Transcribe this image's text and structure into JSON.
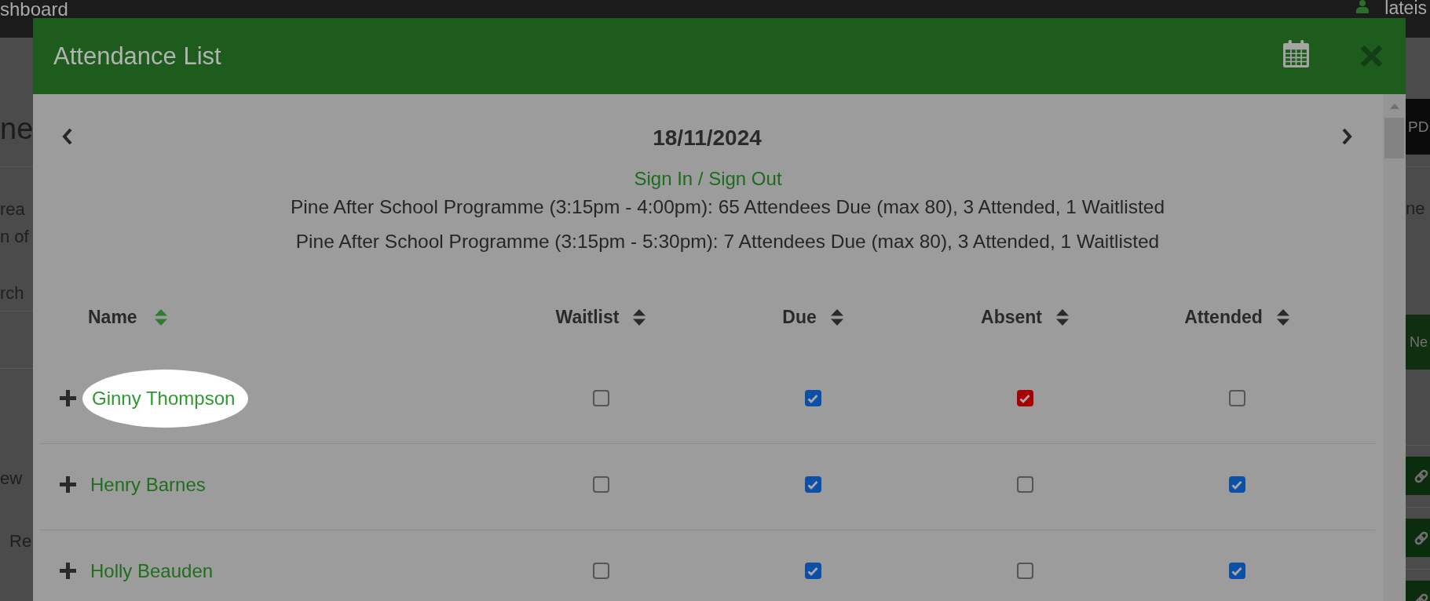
{
  "top_bar": {
    "title": "shboard",
    "user_name": "lateis"
  },
  "background_page": {
    "heading": "ne",
    "description": [
      "rea",
      "n of"
    ],
    "search": {
      "placeholder": "rch"
    },
    "list_items": [
      "ew",
      "Re"
    ],
    "action_button": "PD",
    "side_text": "ne",
    "primary_button": "Ne"
  },
  "dialog": {
    "title": "Attendance List",
    "date": "18/11/2024",
    "sign_in_link": "Sign In / Sign Out",
    "sessions": [
      "Pine After School Programme (3:15pm - 4:00pm): 65 Attendees Due (max 80), 3 Attended, 1 Waitlisted",
      "Pine After School Programme (3:15pm - 5:30pm): 7 Attendees Due (max 80), 3 Attended, 1 Waitlisted"
    ],
    "table": {
      "columns": [
        {
          "label": "Name",
          "sorted": true
        },
        {
          "label": "Waitlist",
          "sorted": false
        },
        {
          "label": "Due",
          "sorted": false
        },
        {
          "label": "Absent",
          "sorted": false,
          "color": "#a80000"
        },
        {
          "label": "Attended",
          "sorted": false
        }
      ],
      "rows": [
        {
          "name": "Ginny Thompson",
          "expanded": false,
          "highlighted": true,
          "checks": [
            false,
            true,
            true,
            false
          ]
        },
        {
          "name": "Henry Barnes",
          "expanded": false,
          "highlighted": false,
          "checks": [
            false,
            true,
            false,
            true
          ]
        },
        {
          "name": "Holly Beauden",
          "expanded": false,
          "highlighted": false,
          "checks": [
            false,
            true,
            false,
            true
          ]
        }
      ]
    }
  }
}
